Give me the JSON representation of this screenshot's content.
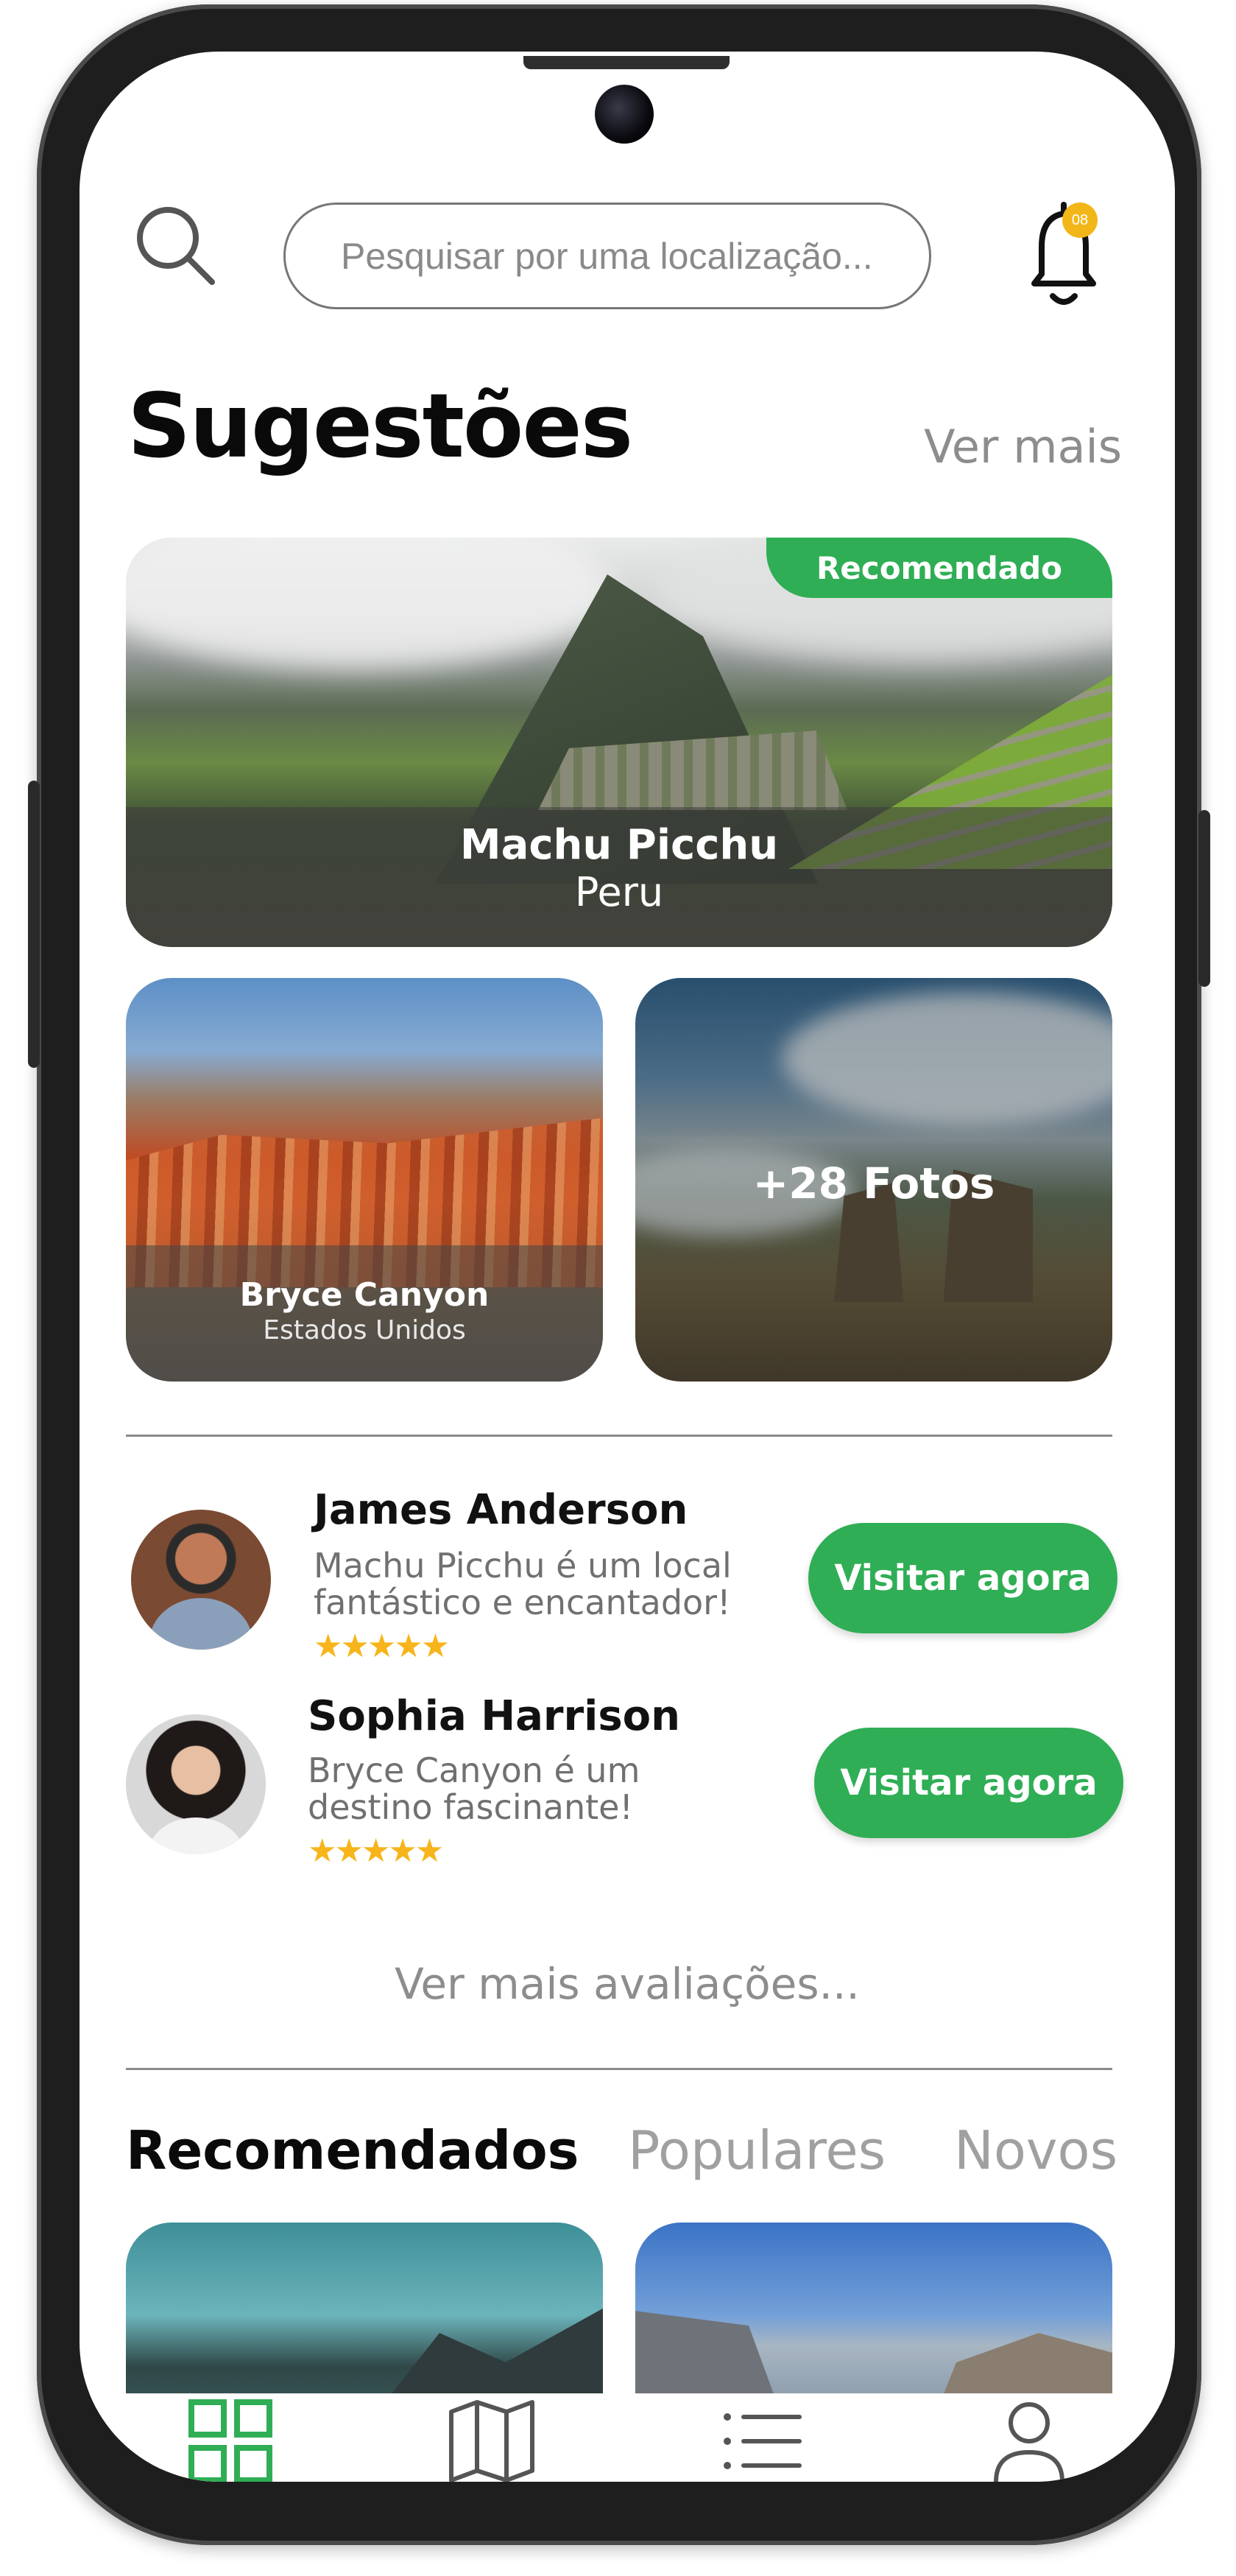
{
  "header": {
    "search_placeholder": "Pesquisar por uma localização...",
    "notification_badge": "08"
  },
  "suggestions": {
    "title": "Sugestões",
    "more_link": "Ver mais",
    "featured": {
      "badge": "Recomendado",
      "name": "Machu Picchu",
      "country": "Peru"
    },
    "cards": [
      {
        "name": "Bryce Canyon",
        "country": "Estados Unidos"
      },
      {
        "photos_label": "+28 Fotos"
      }
    ]
  },
  "reviews": {
    "items": [
      {
        "name": "James Anderson",
        "text_line1": "Machu Picchu é um local",
        "text_line2": "fantástico e encantador!",
        "stars": "★★★★★",
        "rating": 5,
        "button_label": "Visitar agora"
      },
      {
        "name": "Sophia Harrison",
        "text_line1": "Bryce Canyon é um",
        "text_line2": "destino fascinante!",
        "stars": "★★★★★",
        "rating": 5,
        "button_label": "Visitar agora"
      }
    ],
    "more_link": "Ver mais avaliações..."
  },
  "tabs": [
    {
      "label": "Recomendados",
      "active": true
    },
    {
      "label": "Populares",
      "active": false
    },
    {
      "label": "Novos",
      "active": false
    }
  ],
  "bottom_nav": {
    "items": [
      "grid-icon",
      "map-icon",
      "list-icon",
      "profile-icon"
    ],
    "active_index": 0
  },
  "colors": {
    "accent": "#2fae55",
    "star": "#f7b51b",
    "badge": "#f2b619"
  }
}
